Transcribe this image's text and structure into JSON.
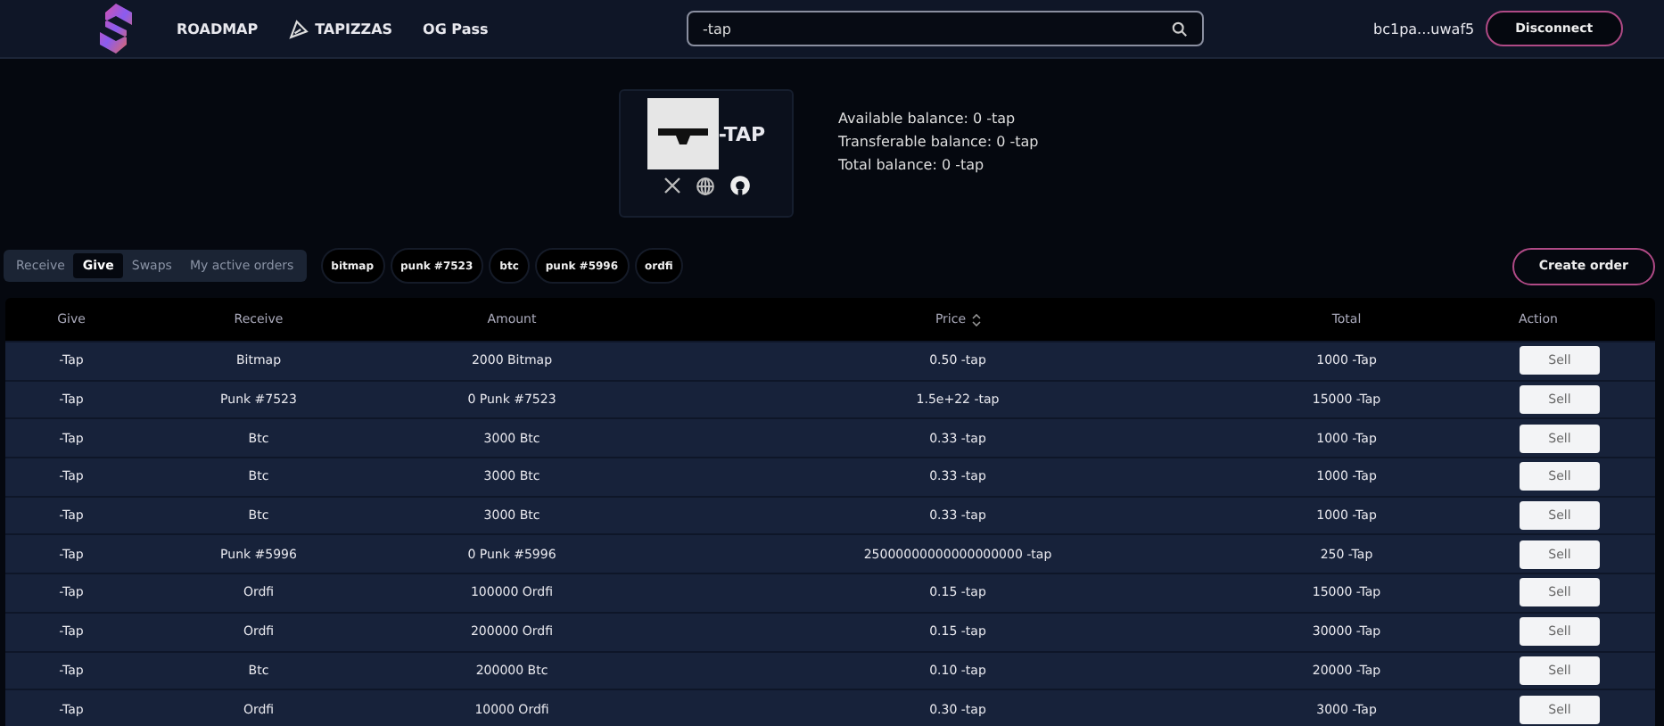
{
  "nav": {
    "links": [
      {
        "label": "ROADMAP",
        "icon": false
      },
      {
        "label": "TAPIZZAS",
        "icon": true
      },
      {
        "label": "OG Pass",
        "icon": false
      }
    ],
    "search": {
      "value": "-tap"
    },
    "address": "bc1pa...uwaf5",
    "disconnect": "Disconnect"
  },
  "token": {
    "name": "-TAP",
    "balances": [
      "Available balance: 0 -tap",
      "Transferable balance: 0 -tap",
      "Total balance: 0 -tap"
    ]
  },
  "tabs": [
    {
      "label": "Receive",
      "selected": false
    },
    {
      "label": "Give",
      "selected": true
    },
    {
      "label": "Swaps",
      "selected": false
    },
    {
      "label": "My active orders",
      "selected": false
    }
  ],
  "filters": [
    "bitmap",
    "punk #7523",
    "btc",
    "punk #5996",
    "ordfi"
  ],
  "create_order": "Create order",
  "table": {
    "columns": [
      {
        "label": "Give",
        "sortable": false
      },
      {
        "label": "Receive",
        "sortable": false
      },
      {
        "label": "Amount",
        "sortable": false
      },
      {
        "label": "Price",
        "sortable": true
      },
      {
        "label": "Total",
        "sortable": false
      },
      {
        "label": "Action",
        "sortable": false
      }
    ],
    "rows": [
      [
        "-Tap",
        "Bitmap",
        "2000 Bitmap",
        "0.50 -tap",
        "1000 -Tap",
        "Sell"
      ],
      [
        "-Tap",
        "Punk #7523",
        "0 Punk #7523",
        "1.5e+22 -tap",
        "15000 -Tap",
        "Sell"
      ],
      [
        "-Tap",
        "Btc",
        "3000 Btc",
        "0.33 -tap",
        "1000 -Tap",
        "Sell"
      ],
      [
        "-Tap",
        "Btc",
        "3000 Btc",
        "0.33 -tap",
        "1000 -Tap",
        "Sell"
      ],
      [
        "-Tap",
        "Btc",
        "3000 Btc",
        "0.33 -tap",
        "1000 -Tap",
        "Sell"
      ],
      [
        "-Tap",
        "Punk #5996",
        "0 Punk #5996",
        "25000000000000000000 -tap",
        "250 -Tap",
        "Sell"
      ],
      [
        "-Tap",
        "Ordfi",
        "100000 Ordfi",
        "0.15 -tap",
        "15000 -Tap",
        "Sell"
      ],
      [
        "-Tap",
        "Ordfi",
        "200000 Ordfi",
        "0.15 -tap",
        "30000 -Tap",
        "Sell"
      ],
      [
        "-Tap",
        "Btc",
        "200000 Btc",
        "0.10 -tap",
        "20000 -Tap",
        "Sell"
      ],
      [
        "-Tap",
        "Ordfi",
        "10000 Ordfi",
        "0.30 -tap",
        "3000 -Tap",
        "Sell"
      ]
    ]
  }
}
